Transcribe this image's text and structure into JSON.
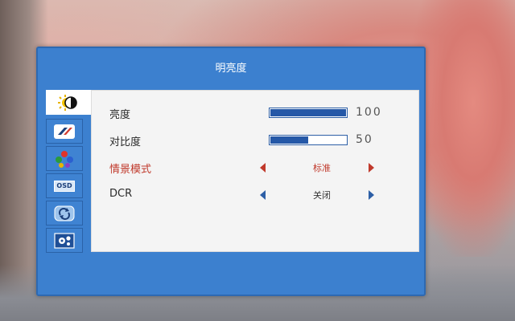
{
  "menu": {
    "title": "明亮度",
    "tabs": [
      {
        "icon": "brightness-contrast-icon",
        "active": true
      },
      {
        "icon": "picture-mode-icon",
        "active": false
      },
      {
        "icon": "color-icon",
        "active": false
      },
      {
        "icon": "osd-settings-icon",
        "active": false
      },
      {
        "icon": "reset-icon",
        "active": false
      },
      {
        "icon": "setup-icon",
        "active": false
      }
    ],
    "rows": [
      {
        "label": "亮度",
        "value": "100",
        "level": 100
      },
      {
        "label": "对比度",
        "value": "50",
        "level": 50
      },
      {
        "label": "情景模式",
        "value": "标准",
        "selected": true
      },
      {
        "label": "DCR",
        "value": "关闭"
      }
    ]
  },
  "colors": {
    "frame": "#3c80cf",
    "panel": "#f4f4f4",
    "bar_fill": "#2558a7",
    "selected_text": "#c0392b"
  }
}
